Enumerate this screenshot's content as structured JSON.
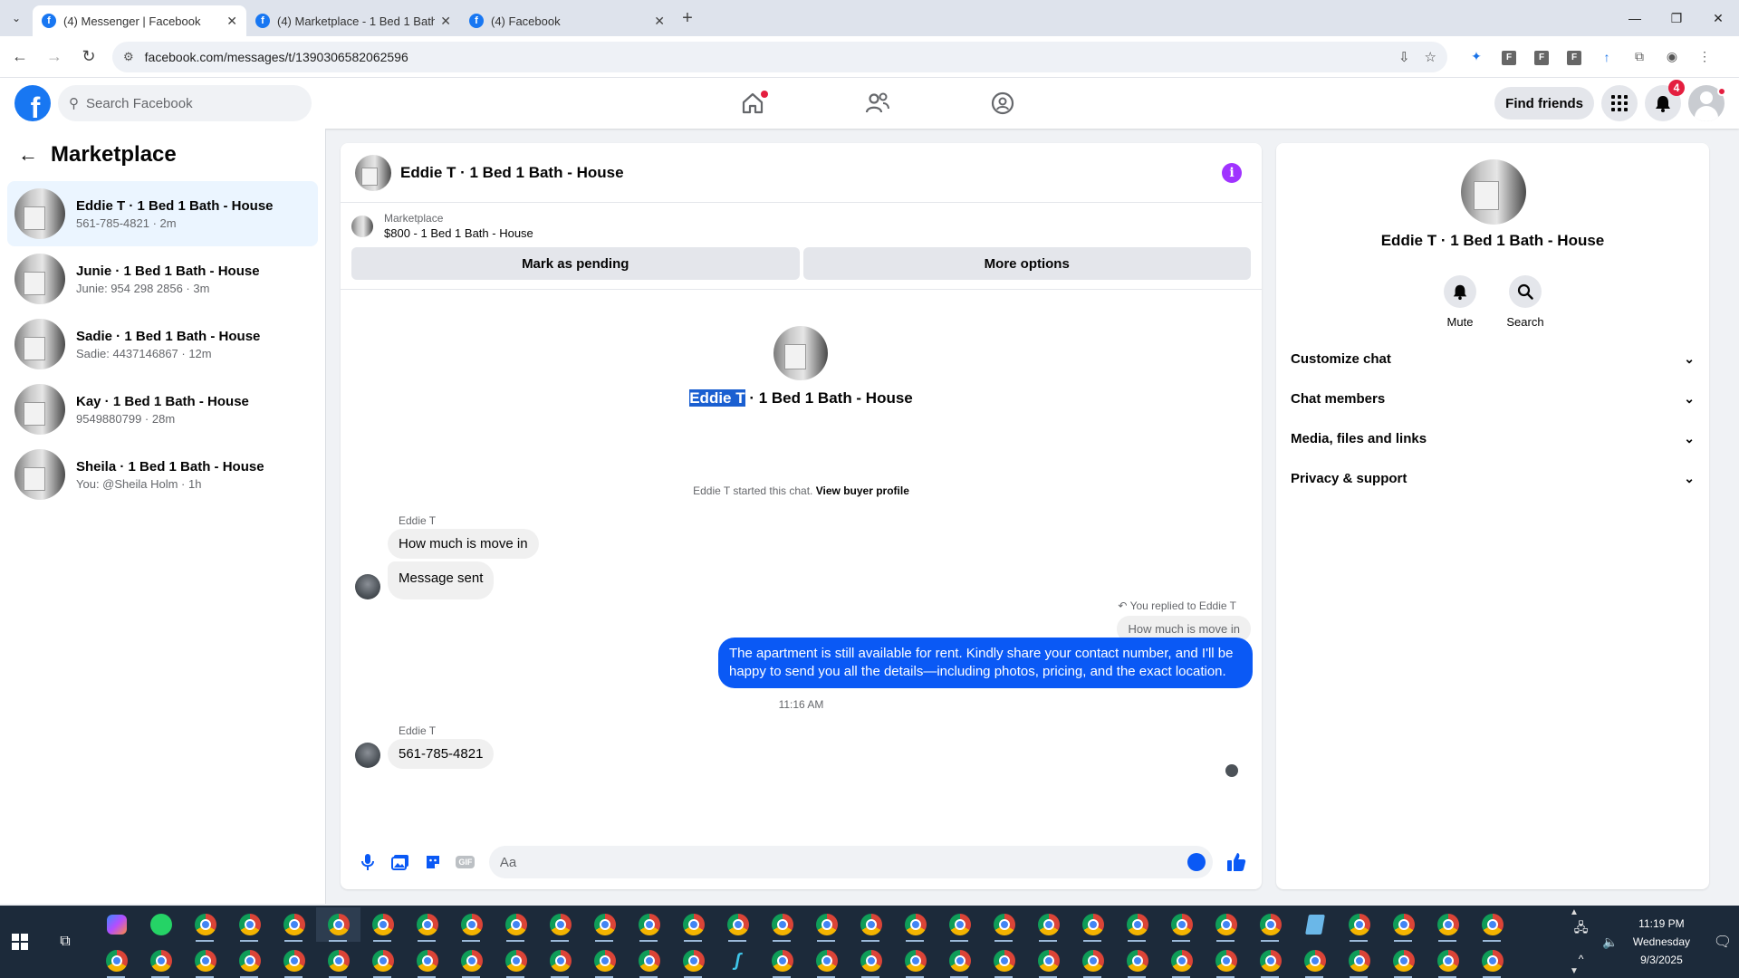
{
  "browser": {
    "tabs": [
      {
        "title": "(4) Messenger | Facebook",
        "active": true
      },
      {
        "title": "(4) Marketplace - 1 Bed 1 Bath",
        "active": false
      },
      {
        "title": "(4) Facebook",
        "active": false
      }
    ],
    "url": "facebook.com/messages/t/1390306582062596",
    "extension_labels": [
      "F",
      "F",
      "F"
    ]
  },
  "header": {
    "search_placeholder": "Search Facebook",
    "find_friends_label": "Find friends",
    "notification_count": "4"
  },
  "sidebar": {
    "title": "Marketplace",
    "conversations": [
      {
        "name": "Eddie T · 1 Bed 1 Bath - House",
        "sub": "561-785-4821 · 2m"
      },
      {
        "name": "Junie · 1 Bed 1 Bath - House",
        "sub": "Junie: 954 298 2856 · 3m"
      },
      {
        "name": "Sadie · 1 Bed 1 Bath - House",
        "sub": "Sadie: 4437146867 · 12m"
      },
      {
        "name": "Kay · 1 Bed 1 Bath - House",
        "sub": "9549880799 · 28m"
      },
      {
        "name": "Sheila · 1 Bed 1 Bath - House",
        "sub": "You: @Sheila Holm · 1h"
      }
    ]
  },
  "chat": {
    "title": "Eddie T · 1 Bed 1 Bath - House",
    "listing_label": "Marketplace",
    "listing_title": "$800 - 1 Bed 1 Bath - House",
    "mark_pending_label": "Mark as pending",
    "more_options_label": "More options",
    "intro_name_highlight": "Eddie T",
    "intro_name_rest": " · 1 Bed 1 Bath - House",
    "started_text": "Eddie T started this chat. ",
    "view_profile_label": "View buyer profile",
    "messages": {
      "sender1": "Eddie T",
      "msg1": "How much is move in",
      "msg2": "Message sent",
      "replied_label": "You replied to Eddie T",
      "quoted": "How much is move in",
      "outgoing": "The apartment is still available for rent. Kindly share your contact number, and I'll be happy to send you all the details—including photos, pricing, and the exact location.",
      "timestamp": "11:16 AM",
      "sender2": "Eddie T",
      "msg3": "561-785-4821"
    },
    "composer_placeholder": "Aa"
  },
  "right_panel": {
    "name": "Eddie T · 1 Bed 1 Bath - House",
    "mute_label": "Mute",
    "search_label": "Search",
    "sections": [
      "Customize chat",
      "Chat members",
      "Media, files and links",
      "Privacy & support"
    ]
  },
  "taskbar": {
    "time": "11:19 PM",
    "day": "Wednesday",
    "date": "9/3/2025"
  },
  "colors": {
    "fb_blue": "#1877f2",
    "messenger_blue": "#0a59f5",
    "info_purple": "#a033ff",
    "badge_red": "#e41e3f"
  }
}
